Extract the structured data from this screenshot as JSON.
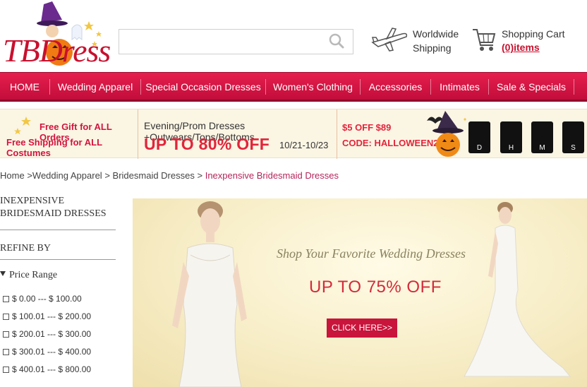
{
  "header": {
    "logo_text": "TBDress",
    "search": {
      "value": "",
      "placeholder": ""
    },
    "shipping": {
      "line1": "Worldwide",
      "line2": "Shipping"
    },
    "cart": {
      "label": "Shopping Cart",
      "count": "(0)items"
    }
  },
  "nav": {
    "items": [
      {
        "label": "HOME"
      },
      {
        "label": "Wedding Apparel"
      },
      {
        "label": "Special Occasion Dresses"
      },
      {
        "label": "Women's Clothing"
      },
      {
        "label": "Accessories"
      },
      {
        "label": "Intimates"
      },
      {
        "label": "Sale & Specials"
      }
    ]
  },
  "promo": {
    "left_line1": "Free Gift for ALL Orders",
    "left_line2": "Free Shipping for ALL Costumes",
    "mid_line1": "Evening/Prom Dresses +Outwears/Tops/Bottoms",
    "mid_line2": "UP TO 80% OFF",
    "mid_dates": "10/21-10/23",
    "right_line1": "$5 OFF $89",
    "right_line2": "CODE: HALLOWEEN2014",
    "countdown": [
      "D",
      "H",
      "M",
      "S"
    ]
  },
  "breadcrumb": {
    "home": "Home",
    "sep": ">",
    "level1": "Wedding Apparel",
    "level2": "Bridesmaid Dresses",
    "current": "Inexpensive Bridesmaid Dresses"
  },
  "sidebar": {
    "title_line1": "INEXPENSIVE",
    "title_line2": "BRIDESMAID DRESSES",
    "refine_label": "REFINE BY",
    "price_range_label": "Price Range",
    "price_options": [
      "$ 0.00 --- $ 100.00",
      "$ 100.01 --- $ 200.00",
      "$ 200.01 --- $ 300.00",
      "$ 300.01 --- $ 400.00",
      "$ 400.01 --- $ 800.00"
    ]
  },
  "banner": {
    "title": "Shop Your Favorite Wedding Dresses",
    "offer": "UP TO 75% OFF",
    "button": "CLICK  HERE>>"
  },
  "colors": {
    "brand_red": "#c8102e",
    "nav_red": "#d9174a",
    "promo_bg": "#fbf5e4",
    "link_current": "#b4245a"
  }
}
